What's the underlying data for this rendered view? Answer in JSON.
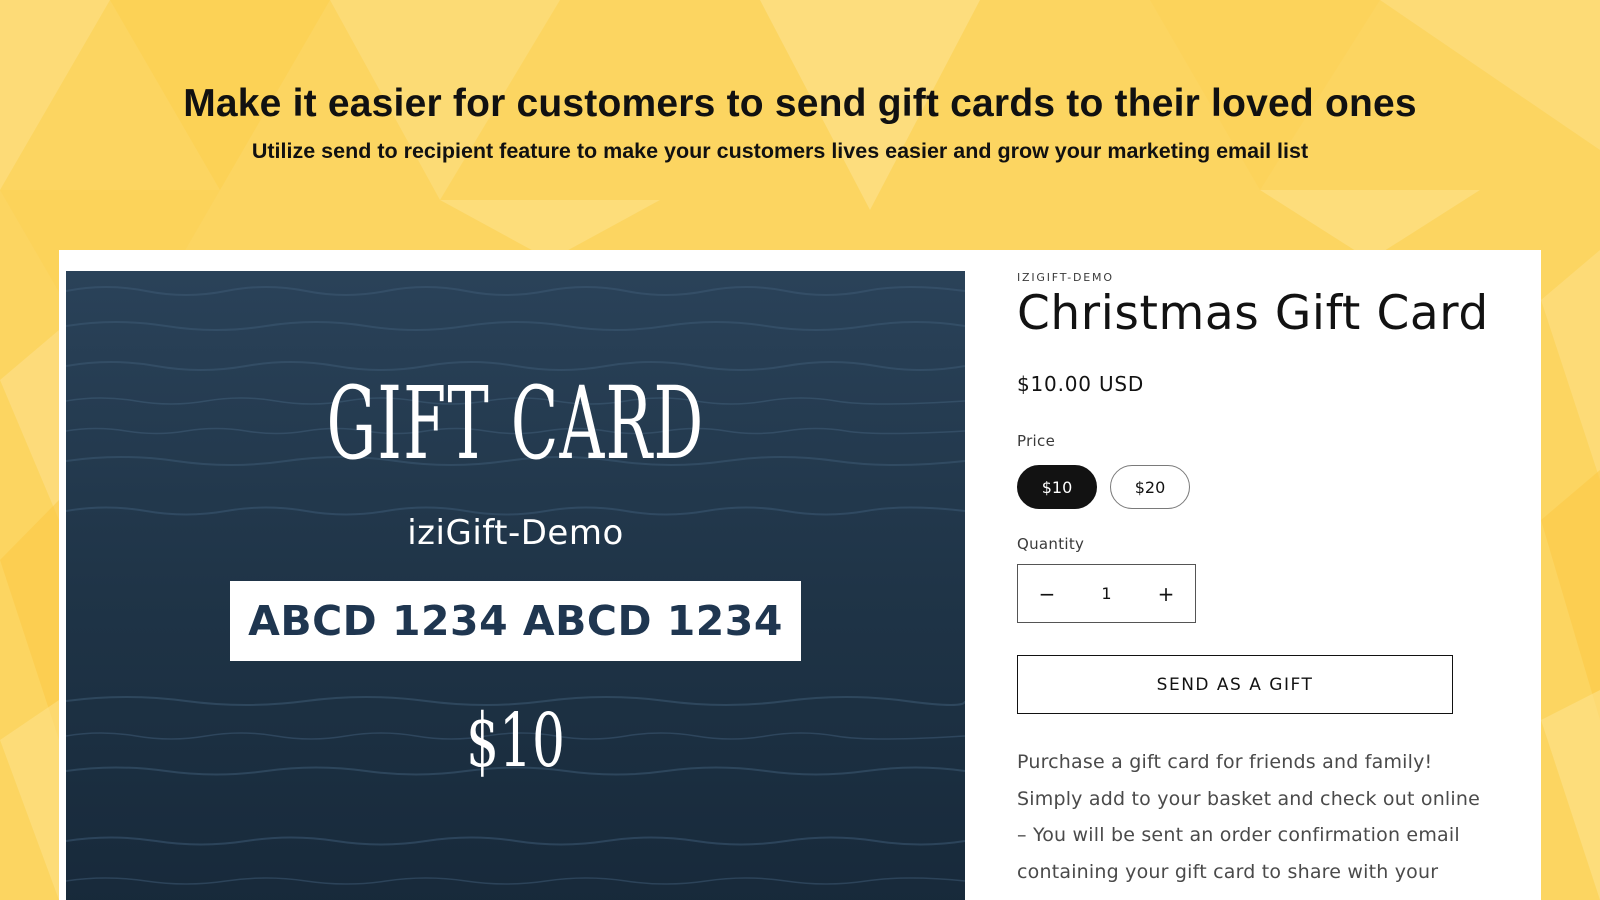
{
  "banner": {
    "headline": "Make it easier for customers to send gift cards to their loved ones",
    "subline": "Utilize send to recipient feature to make your customers lives easier and grow your marketing email list"
  },
  "product_image": {
    "title": "GIFT CARD",
    "shop_name": "iziGift-Demo",
    "code": "ABCD 1234 ABCD 1234",
    "amount": "$10"
  },
  "product": {
    "vendor": "IZIGIFT-DEMO",
    "title": "Christmas Gift Card",
    "price": "$10.00 USD",
    "price_label": "Price",
    "price_options": [
      "$10",
      "$20"
    ],
    "selected_price": "$10",
    "quantity_label": "Quantity",
    "quantity": "1",
    "quantity_decrease_symbol": "−",
    "quantity_increase_symbol": "+",
    "send_gift_label": "SEND AS A GIFT",
    "description_lines": [
      "Purchase a gift card for friends and family!",
      "Simply add to your basket and check out online",
      "– You will be sent an order confirmation email",
      "containing your gift card to share with your"
    ]
  },
  "colors": {
    "background": "#fcd561",
    "selected_pill": "#121212",
    "card_code_text": "#1f3650",
    "ocean_dark": "#1d3346"
  },
  "icons": {
    "decrease": "minus-icon",
    "increase": "plus-icon"
  }
}
